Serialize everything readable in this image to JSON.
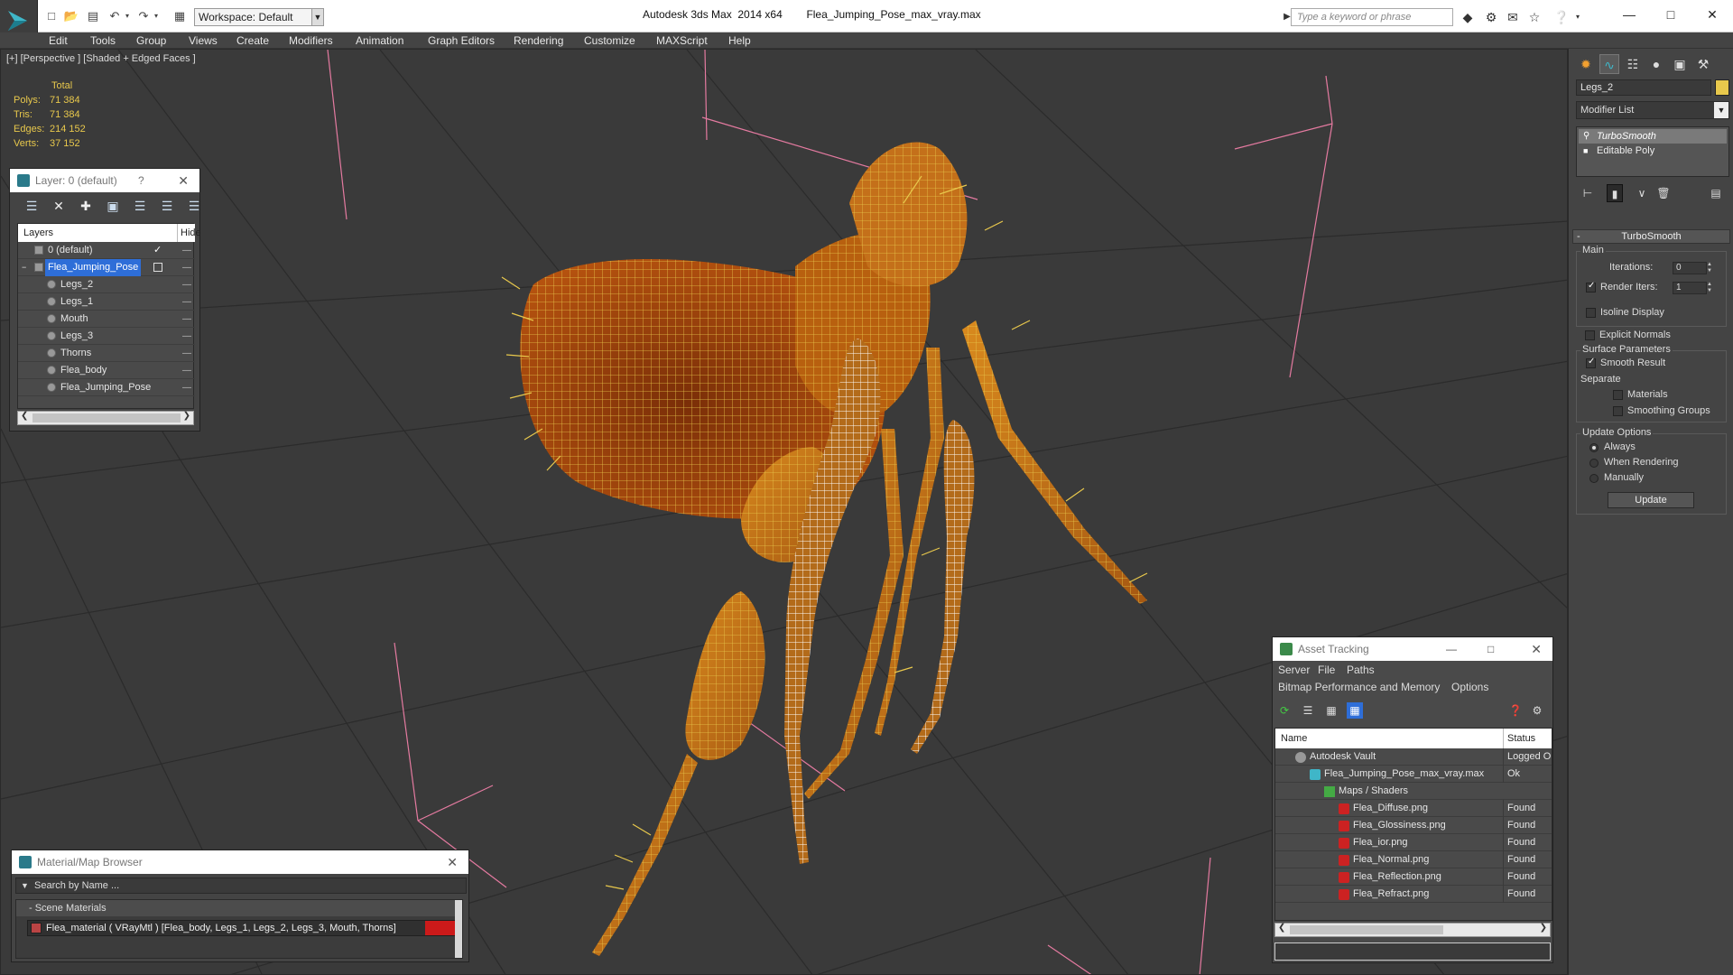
{
  "window": {
    "app_title": "Autodesk 3ds Max  2014 x64",
    "file_name": "Flea_Jumping_Pose_max_vray.max",
    "workspace_label": "Workspace: Default",
    "search_placeholder": "Type a keyword or phrase"
  },
  "menu": [
    "Edit",
    "Tools",
    "Group",
    "Views",
    "Create",
    "Modifiers",
    "Animation",
    "Graph Editors",
    "Rendering",
    "Customize",
    "MAXScript",
    "Help"
  ],
  "viewport": {
    "label": "[+] [Perspective ] [Shaded + Edged Faces ]",
    "stats": {
      "header": "Total",
      "rows": [
        {
          "key": "Polys:",
          "value": "71 384"
        },
        {
          "key": "Tris:",
          "value": "71 384"
        },
        {
          "key": "Edges:",
          "value": "214 152"
        },
        {
          "key": "Verts:",
          "value": "37 152"
        }
      ]
    },
    "wire_color": "#e8c84c",
    "selected_wire_color": "#ffffff"
  },
  "layer_panel": {
    "title": "Layer: 0 (default)",
    "help": "?",
    "col_layers": "Layers",
    "col_hide": "Hide",
    "rows": [
      {
        "name": "0 (default)",
        "indent": 0,
        "checked": true
      },
      {
        "name": "Flea_Jumping_Pose",
        "indent": 0,
        "selected": true
      },
      {
        "name": "Legs_2",
        "indent": 1
      },
      {
        "name": "Legs_1",
        "indent": 1
      },
      {
        "name": "Mouth",
        "indent": 1
      },
      {
        "name": "Legs_3",
        "indent": 1
      },
      {
        "name": "Thorns",
        "indent": 1
      },
      {
        "name": "Flea_body",
        "indent": 1
      },
      {
        "name": "Flea_Jumping_Pose",
        "indent": 1
      }
    ]
  },
  "material_browser": {
    "title": "Material/Map Browser",
    "search_placeholder": "Search by Name ...",
    "group": "- Scene Materials",
    "item": "Flea_material  ( VRayMtl )  [Flea_body, Legs_1, Legs_2, Legs_3, Mouth, Thorns]"
  },
  "asset_tracking": {
    "title": "Asset Tracking",
    "menus_row1": [
      "Server",
      "File",
      "Paths"
    ],
    "menus_row2": [
      "Bitmap Performance and Memory",
      "Options"
    ],
    "col_name": "Name",
    "col_status": "Status",
    "rows": [
      {
        "name": "Autodesk Vault",
        "status": "Logged O",
        "level": 1,
        "icon": "vault"
      },
      {
        "name": "Flea_Jumping_Pose_max_vray.max",
        "status": "Ok",
        "level": 2,
        "icon": "max"
      },
      {
        "name": "Maps / Shaders",
        "status": "",
        "level": 3,
        "icon": "folder"
      },
      {
        "name": "Flea_Diffuse.png",
        "status": "Found",
        "level": 4,
        "icon": "png"
      },
      {
        "name": "Flea_Glossiness.png",
        "status": "Found",
        "level": 4,
        "icon": "png"
      },
      {
        "name": "Flea_ior.png",
        "status": "Found",
        "level": 4,
        "icon": "png"
      },
      {
        "name": "Flea_Normal.png",
        "status": "Found",
        "level": 4,
        "icon": "png"
      },
      {
        "name": "Flea_Reflection.png",
        "status": "Found",
        "level": 4,
        "icon": "png"
      },
      {
        "name": "Flea_Refract.png",
        "status": "Found",
        "level": 4,
        "icon": "png"
      }
    ]
  },
  "command_panel": {
    "object_name": "Legs_2",
    "object_color": "#e8c84c",
    "modifier_list": "Modifier List",
    "stack": [
      {
        "name": "TurboSmooth",
        "selected": true
      },
      {
        "name": "Editable Poly",
        "selected": false
      }
    ],
    "rollout": {
      "title": "TurboSmooth",
      "collapse": "-",
      "main_label": "Main",
      "iterations_label": "Iterations:",
      "iterations_value": "0",
      "render_iters_label": "Render Iters:",
      "render_iters_value": "1",
      "render_iters_checked": true,
      "isoline_label": "Isoline Display",
      "explicit_label": "Explicit Normals",
      "surface_label": "Surface Parameters",
      "smooth_result_label": "Smooth Result",
      "separate_label": "Separate",
      "materials_label": "Materials",
      "smoothing_groups_label": "Smoothing Groups",
      "update_options_label": "Update Options",
      "always_label": "Always",
      "when_rendering_label": "When Rendering",
      "manually_label": "Manually",
      "update_button": "Update"
    }
  }
}
